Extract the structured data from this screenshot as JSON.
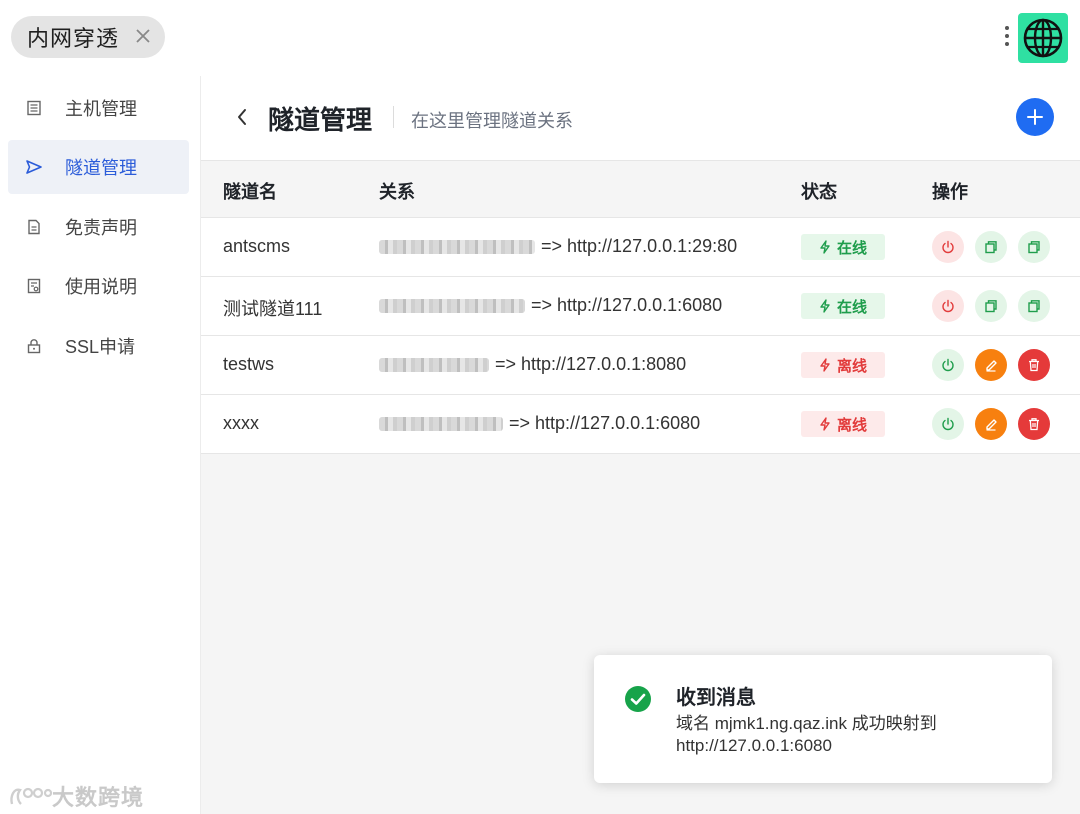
{
  "app_tab": {
    "title": "内网穿透"
  },
  "sidebar": {
    "items": [
      {
        "label": "主机管理",
        "icon": "list-icon",
        "active": false
      },
      {
        "label": "隧道管理",
        "icon": "send-icon",
        "active": true
      },
      {
        "label": "免责声明",
        "icon": "document-icon",
        "active": false
      },
      {
        "label": "使用说明",
        "icon": "guide-icon",
        "active": false
      },
      {
        "label": "SSL申请",
        "icon": "lock-icon",
        "active": false
      }
    ],
    "watermark": "大数跨境"
  },
  "header": {
    "title": "隧道管理",
    "subtitle": "在这里管理隧道关系"
  },
  "table": {
    "columns": [
      "隧道名",
      "关系",
      "状态",
      "操作"
    ],
    "rows": [
      {
        "name": "antscms",
        "target": "=> http://127.0.0.1:29:80",
        "status": "在线",
        "state": "online"
      },
      {
        "name": "测试隧道111",
        "target": "=> http://127.0.0.1:6080",
        "status": "在线",
        "state": "online"
      },
      {
        "name": "testws",
        "target": "=> http://127.0.0.1:8080",
        "status": "离线",
        "state": "offline"
      },
      {
        "name": "xxxx",
        "target": "=> http://127.0.0.1:6080",
        "status": "离线",
        "state": "offline"
      }
    ]
  },
  "toast": {
    "title": "收到消息",
    "body": "域名 mjmk1.ng.qaz.ink 成功映射到 http://127.0.0.1:6080"
  },
  "colors": {
    "accent": "#1f6cf2",
    "online": "#1f9d4c",
    "offline": "#e23b3b",
    "edit": "#f7800f",
    "delete": "#e53a3a",
    "globe_bg": "#2fe0a2"
  }
}
